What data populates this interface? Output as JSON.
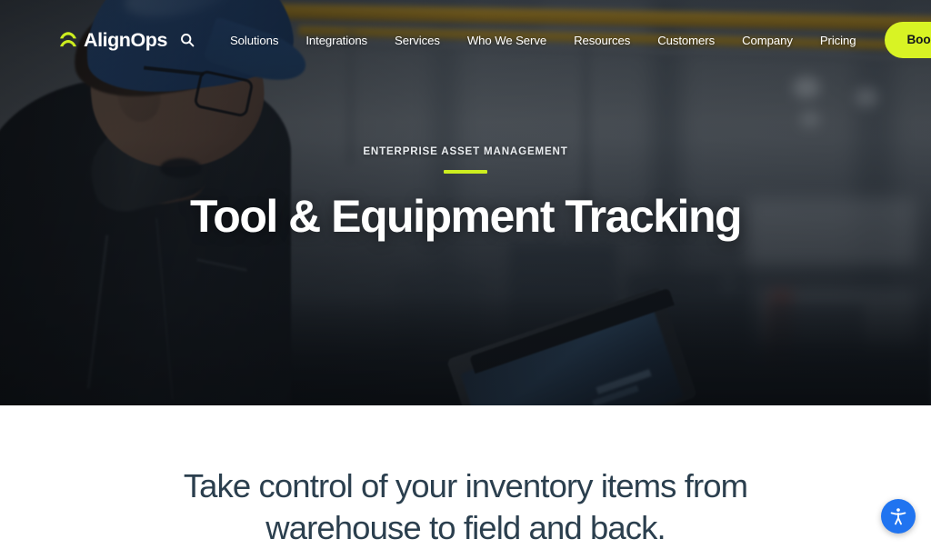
{
  "brand": {
    "name": "AlignOps",
    "mark_icon": "alignops-chevron-logo",
    "mark_color": "#cdee1f"
  },
  "nav": {
    "search_icon": "search-icon",
    "links": [
      {
        "label": "Solutions"
      },
      {
        "label": "Integrations"
      },
      {
        "label": "Services"
      },
      {
        "label": "Who We Serve"
      },
      {
        "label": "Resources"
      },
      {
        "label": "Customers"
      },
      {
        "label": "Company"
      },
      {
        "label": "Pricing"
      }
    ],
    "cta": {
      "label": "Book a Demo",
      "bg_color": "#d8f324",
      "text_color": "#14181b"
    }
  },
  "hero": {
    "eyebrow": "ENTERPRISE ASSET MANAGEMENT",
    "accent_color": "#cdee1f",
    "title": "Tool & Equipment Tracking",
    "background_image": "industrial-worker-with-laptop-in-warehouse"
  },
  "section": {
    "heading": "Take control of your inventory items from warehouse to field and back.",
    "heading_color": "#2b3f4e"
  },
  "accessibility_widget": {
    "icon": "accessibility-person-icon",
    "bg_color": "#2074f0"
  }
}
